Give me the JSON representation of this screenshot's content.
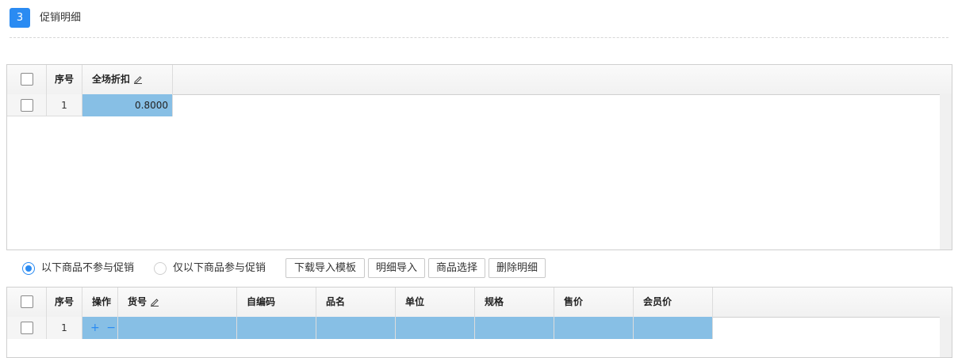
{
  "section": {
    "step": "3",
    "title": "促销明细"
  },
  "discount_grid": {
    "columns": {
      "index": "序号",
      "discount": "全场折扣"
    },
    "rows": [
      {
        "index": "1",
        "discount": "0.8000"
      }
    ]
  },
  "options": {
    "exclude_label": "以下商品不参与促销",
    "include_label": "仅以下商品参与促销",
    "selected": "exclude"
  },
  "toolbar": {
    "download_template": "下载导入模板",
    "import_detail": "明细导入",
    "select_product": "商品选择",
    "delete_detail": "删除明细"
  },
  "product_grid": {
    "columns": {
      "index": "序号",
      "action": "操作",
      "sku": "货号",
      "code": "自编码",
      "name": "品名",
      "unit": "单位",
      "spec": "规格",
      "price": "售价",
      "member_price": "会员价"
    },
    "rows": [
      {
        "index": "1",
        "add": "+",
        "remove": "−"
      }
    ]
  },
  "colors": {
    "accent": "#2a8bf2",
    "cell_highlight": "#87bfe5"
  }
}
